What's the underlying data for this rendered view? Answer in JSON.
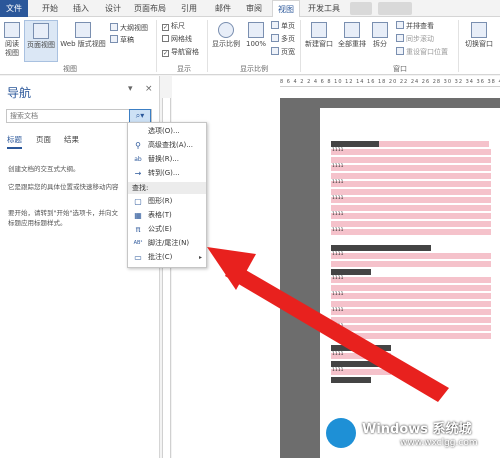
{
  "tabs": [
    {
      "label": "文件",
      "state": "file"
    },
    {
      "label": "开始",
      "state": ""
    },
    {
      "label": "插入",
      "state": ""
    },
    {
      "label": "设计",
      "state": ""
    },
    {
      "label": "页面布局",
      "state": ""
    },
    {
      "label": "引用",
      "state": ""
    },
    {
      "label": "邮件",
      "state": ""
    },
    {
      "label": "审阅",
      "state": ""
    },
    {
      "label": "视图",
      "state": "active"
    },
    {
      "label": "开发工具",
      "state": ""
    }
  ],
  "ribbon": {
    "views": {
      "read_mode": "阅读\n视图",
      "print_layout": "页面视图",
      "web_layout": "Web 版式视图",
      "outline": "大纲视图",
      "draft": "草稿",
      "group_label": "视图"
    },
    "show": {
      "ruler": "标尺",
      "gridlines": "网格线",
      "nav_pane": "导航窗格",
      "group_label": "显示"
    },
    "zoom": {
      "zoom": "显示比例",
      "hundred": "100%",
      "one_page": "单页",
      "multi_page": "多页",
      "page_width": "页宽",
      "group_label": "显示比例"
    },
    "window": {
      "new_window": "新建窗口",
      "arrange_all": "全部重排",
      "split": "拆分",
      "side_by_side": "并排查看",
      "sync_scroll": "同步滚动",
      "reset_position": "重设窗口位置",
      "switch_windows": "切换窗口",
      "group_label": "窗口"
    }
  },
  "nav": {
    "title": "导航",
    "collapse": "▾",
    "close": "×",
    "search_placeholder": "搜索文档",
    "search_icon": "⌕",
    "search_dropdown": "▾",
    "tabs": [
      "标题",
      "页面",
      "结果"
    ],
    "text_lines": [
      "创建文档的交互式大纲。",
      "它是跟踪您的具体位置或快速移动内容",
      "要开始，请转到\"开始\"选项卡，并向文",
      "标题应用标题样式。"
    ]
  },
  "dropdown": {
    "items_top": [
      {
        "label": "选项(O)...",
        "icon": ""
      },
      {
        "label": "高级查找(A)...",
        "icon": "binoculars-icon",
        "glyph": "⚲"
      },
      {
        "label": "替换(R)...",
        "icon": "replace-icon",
        "glyph": "ab"
      },
      {
        "label": "转到(G)...",
        "icon": "arrow-right-icon",
        "glyph": "→"
      }
    ],
    "find_header": "查找:",
    "items_find": [
      {
        "label": "图形(R)",
        "icon": "graphic-icon",
        "glyph": "▢"
      },
      {
        "label": "表格(T)",
        "icon": "table-icon",
        "glyph": "▦"
      },
      {
        "label": "公式(E)",
        "icon": "pi-icon",
        "glyph": "π"
      },
      {
        "label": "脚注/尾注(N)",
        "icon": "footnote-icon",
        "glyph": "AB¹"
      },
      {
        "label": "批注(C)",
        "icon": "comment-icon",
        "glyph": "▭"
      }
    ],
    "submenu_arrow": "▸"
  },
  "document": {
    "ruler_text": "8 6 4 2  2 4 6 8 10 12 14 16 18 20 22 24 26 28 30 32 34 36 38 40 42",
    "line_label": "1111"
  },
  "watermark": {
    "title": "Windows 系统城",
    "url": "www.wxclgg.com"
  },
  "colors": {
    "accent": "#2b579a",
    "highlight": "#f5c2cb",
    "arrow": "#e8211e"
  }
}
